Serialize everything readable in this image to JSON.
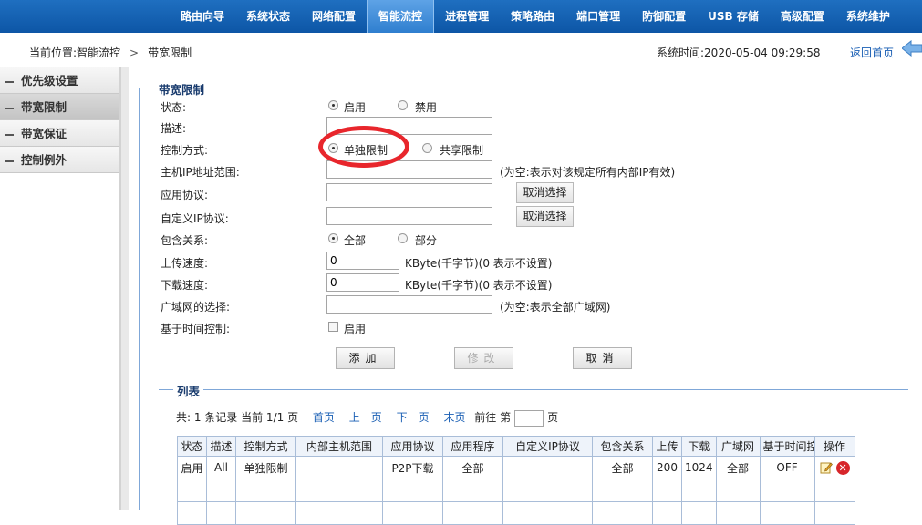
{
  "nav": {
    "items": [
      "路由向导",
      "系统状态",
      "网络配置",
      "智能流控",
      "进程管理",
      "策略路由",
      "端口管理",
      "防御配置",
      "USB 存储",
      "高级配置",
      "系统维护"
    ],
    "active_index": 3
  },
  "breadcrumb": {
    "prefix": "当前位置:智能流控",
    "separator": ">",
    "current": "带宽限制",
    "system_time": "系统时间:2020-05-04 09:29:58",
    "back_label": "返回首页"
  },
  "sidebar": {
    "items": [
      {
        "label": "优先级设置",
        "active": false
      },
      {
        "label": "带宽限制",
        "active": true
      },
      {
        "label": "带宽保证",
        "active": false
      },
      {
        "label": "控制例外",
        "active": false
      }
    ]
  },
  "form": {
    "legend": "带宽限制",
    "status": {
      "label": "状态:",
      "opt1": "启用",
      "opt2": "禁用",
      "selected": "启用"
    },
    "desc": {
      "label": "描述:",
      "value": ""
    },
    "control_mode": {
      "label": "控制方式:",
      "opt1": "单独限制",
      "opt2": "共享限制",
      "selected": "单独限制"
    },
    "host_ip": {
      "label": "主机IP地址范围:",
      "value": "",
      "hint": "(为空:表示对该规定所有内部IP有效)"
    },
    "app_protocol": {
      "label": "应用协议:",
      "value": "",
      "button": "取消选择"
    },
    "custom_ip_protocol": {
      "label": "自定义IP协议:",
      "value": "",
      "button": "取消选择"
    },
    "inclusion": {
      "label": "包含关系:",
      "opt1": "全部",
      "opt2": "部分",
      "selected": "全部"
    },
    "upload": {
      "label": "上传速度:",
      "value": "0",
      "hint": "KByte(千字节)(0 表示不设置)"
    },
    "download": {
      "label": "下载速度:",
      "value": "0",
      "hint": "KByte(千字节)(0 表示不设置)"
    },
    "wan": {
      "label": "广域网的选择:",
      "value": "",
      "hint": "(为空:表示全部广域网)"
    },
    "time_control": {
      "label": "基于时间控制:",
      "checkbox_label": "启用",
      "checked": false
    },
    "buttons": {
      "add": "添加",
      "modify": "修改",
      "cancel": "取消"
    }
  },
  "list": {
    "legend": "列表",
    "summary": "共: 1 条记录 当前 1/1 页",
    "first": "首页",
    "prev": "上一页",
    "next": "下一页",
    "last": "末页",
    "goto_prefix": "前往 第",
    "goto_suffix": "页",
    "columns": [
      "状态",
      "描述",
      "控制方式",
      "内部主机范围",
      "应用协议",
      "应用程序",
      "自定义IP协议",
      "包含关系",
      "上传",
      "下载",
      "广域网",
      "基于时间控制",
      "操作"
    ],
    "rows": [
      [
        "启用",
        "All",
        "单独限制",
        "",
        "P2P下载",
        "全部",
        "",
        "全部",
        "200",
        "1024",
        "全部",
        "OFF"
      ]
    ]
  },
  "colors": {
    "nav_bg": "#1662b6",
    "fieldset_border": "#7fa7d8",
    "annotation_red": "#e8262c",
    "link": "#1a5fb4"
  },
  "icons": [
    "back-arrow-icon",
    "edit-icon",
    "delete-icon",
    "radio-icon",
    "checkbox-icon"
  ]
}
